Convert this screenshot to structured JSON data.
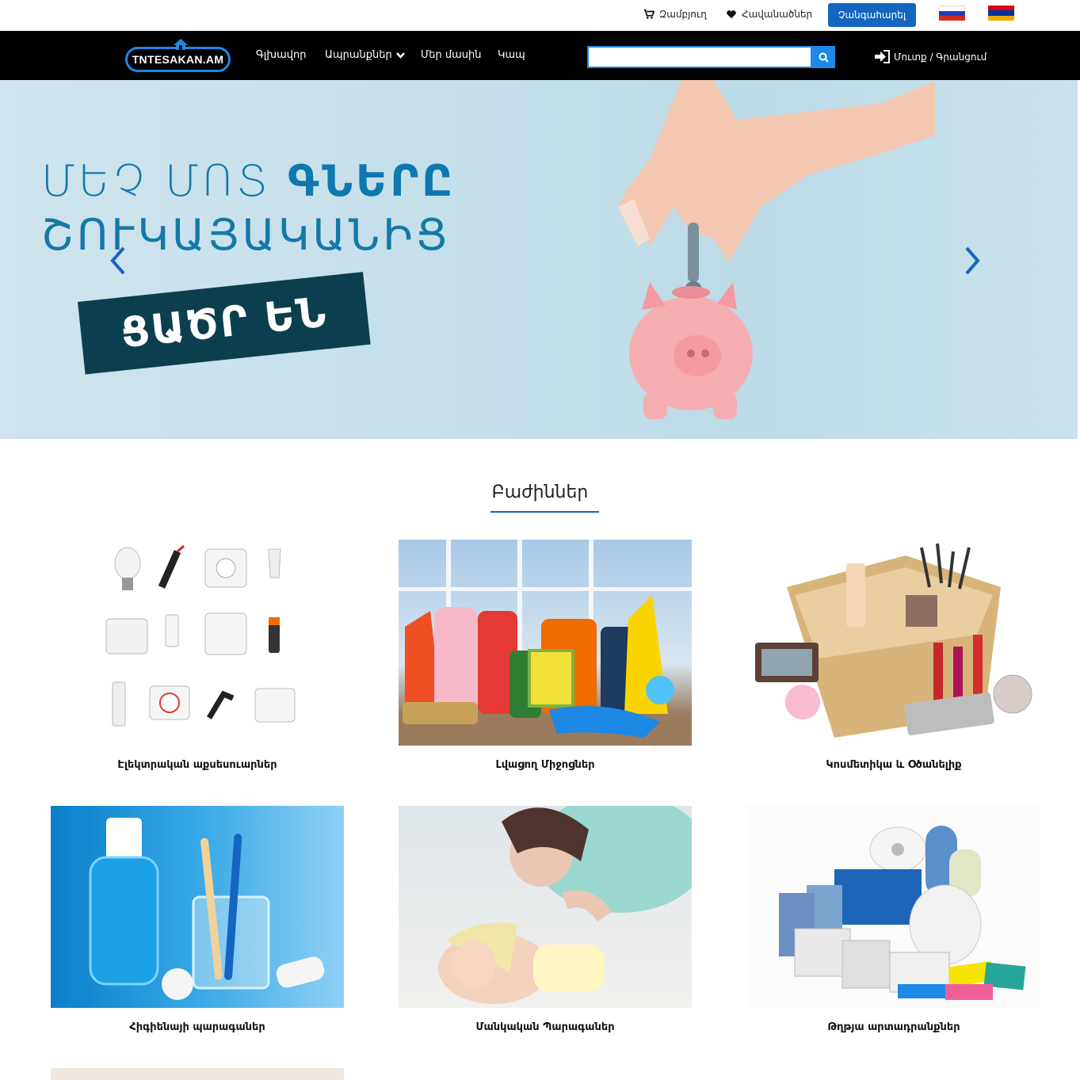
{
  "topbar": {
    "cart_label": "Զամբյուղ",
    "favorites_label": "Հավանածներ",
    "register_label": "Չանգահարել"
  },
  "nav": {
    "logo_text": "TNTESAKAN.AM",
    "items": [
      {
        "label": "Գլխավոր"
      },
      {
        "label": "Ապրանքներ"
      },
      {
        "label": "Մեր մասին"
      },
      {
        "label": "Կապ"
      }
    ],
    "search_placeholder": "",
    "login_label": "Մուտք / Գրանցում"
  },
  "hero": {
    "line1_regular": "ՄԵՉ ՄՈՏ ",
    "line1_bold": "ԳՆԵՐԸ",
    "line2": "ՇՈՒԿԱՅԱԿԱՆԻՑ",
    "banner": "ՑԱԾՐ ԵՆ"
  },
  "sections": {
    "title": "Բաժիններ"
  },
  "categories": [
    {
      "label": "Էլեկտրական աքսեսուարներ"
    },
    {
      "label": "Լվացող Միջոցներ"
    },
    {
      "label": "Կոսմետիկա և Օծանելիք"
    },
    {
      "label": "Հիգիենայի պարագաներ"
    },
    {
      "label": "Մանկական Պարագաներ"
    },
    {
      "label": "Թղթյա արտադրանքներ"
    }
  ],
  "icons": {
    "cart": "cart-icon",
    "heart": "heart-icon",
    "search": "search-icon",
    "login": "sign-in-icon",
    "chevron": "chevron-down-icon",
    "prev": "chevron-left-icon",
    "next": "chevron-right-icon"
  },
  "colors": {
    "accent": "#1565c0",
    "nav_bg": "#000000",
    "hero_text": "#1479a8",
    "banner_bg": "#0c3f4e"
  }
}
